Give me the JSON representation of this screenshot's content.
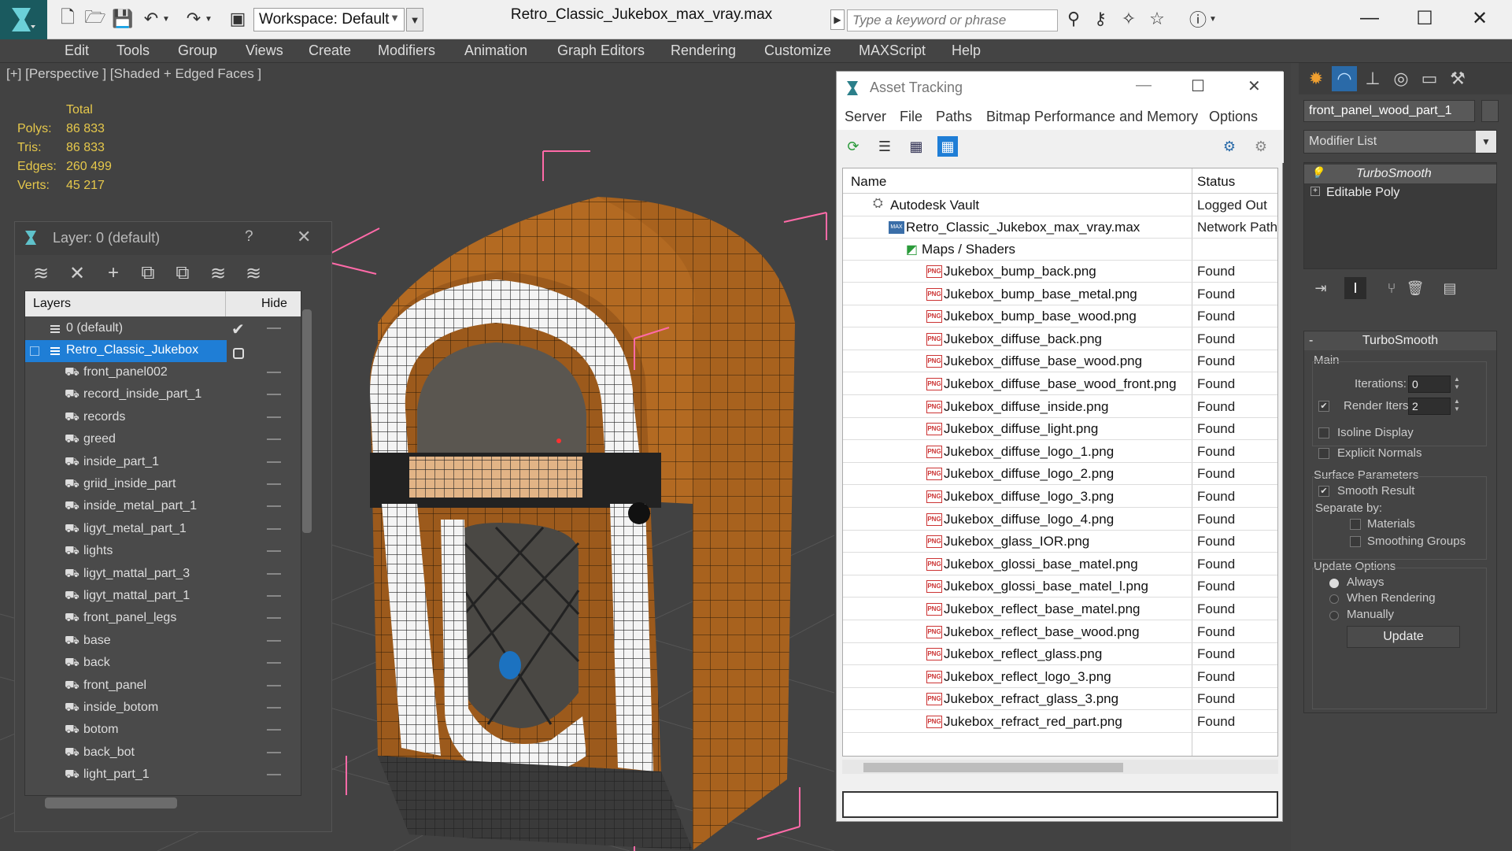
{
  "titlebar": {
    "workspace": "Workspace: Default",
    "doc_title": "Retro_Classic_Jukebox_max_vray.max",
    "search_placeholder": "Type a keyword or phrase"
  },
  "menu": [
    "Edit",
    "Tools",
    "Group",
    "Views",
    "Create",
    "Modifiers",
    "Animation",
    "Graph Editors",
    "Rendering",
    "Customize",
    "MAXScript",
    "Help"
  ],
  "viewport": {
    "label": "[+] [Perspective ] [Shaded + Edged Faces ]",
    "stats_header": "Total",
    "stats": [
      {
        "label": "Polys:",
        "value": "86 833"
      },
      {
        "label": "Tris:",
        "value": "86 833"
      },
      {
        "label": "Edges:",
        "value": "260 499"
      },
      {
        "label": "Verts:",
        "value": "45 217"
      }
    ]
  },
  "layer_panel": {
    "title": "Layer: 0 (default)",
    "help": "?",
    "col_layers": "Layers",
    "col_hide": "Hide",
    "default_layer": "0 (default)",
    "selected_layer": "Retro_Classic_Jukebox",
    "objects": [
      "front_panel002",
      "record_inside_part_1",
      "records",
      "greed",
      "inside_part_1",
      "griid_inside_part",
      "inside_metal_part_1",
      "ligyt_metal_part_1",
      "lights",
      "ligyt_mattal_part_3",
      "ligyt_mattal_part_1",
      "front_panel_legs",
      "base",
      "back",
      "front_panel",
      "inside_botom",
      "botom",
      "back_bot",
      "light_part_1"
    ]
  },
  "asset_panel": {
    "title": "Asset Tracking",
    "menu": [
      "Server",
      "File",
      "Paths",
      "Bitmap Performance and Memory",
      "Options"
    ],
    "col_name": "Name",
    "col_status": "Status",
    "vault": {
      "name": "Autodesk Vault",
      "status": "Logged Out"
    },
    "file": {
      "name": "Retro_Classic_Jukebox_max_vray.max",
      "status": "Network Path"
    },
    "maps": {
      "name": "Maps / Shaders",
      "status": ""
    },
    "files": [
      {
        "name": "Jukebox_bump_back.png",
        "status": "Found"
      },
      {
        "name": "Jukebox_bump_base_metal.png",
        "status": "Found"
      },
      {
        "name": "Jukebox_bump_base_wood.png",
        "status": "Found"
      },
      {
        "name": "Jukebox_diffuse_back.png",
        "status": "Found"
      },
      {
        "name": "Jukebox_diffuse_base_wood.png",
        "status": "Found"
      },
      {
        "name": "Jukebox_diffuse_base_wood_front.png",
        "status": "Found"
      },
      {
        "name": "Jukebox_diffuse_inside.png",
        "status": "Found"
      },
      {
        "name": "Jukebox_diffuse_light.png",
        "status": "Found"
      },
      {
        "name": "Jukebox_diffuse_logo_1.png",
        "status": "Found"
      },
      {
        "name": "Jukebox_diffuse_logo_2.png",
        "status": "Found"
      },
      {
        "name": "Jukebox_diffuse_logo_3.png",
        "status": "Found"
      },
      {
        "name": "Jukebox_diffuse_logo_4.png",
        "status": "Found"
      },
      {
        "name": "Jukebox_glass_IOR.png",
        "status": "Found"
      },
      {
        "name": "Jukebox_glossi_base_matel.png",
        "status": "Found"
      },
      {
        "name": "Jukebox_glossi_base_matel_l.png",
        "status": "Found"
      },
      {
        "name": "Jukebox_reflect_base_matel.png",
        "status": "Found"
      },
      {
        "name": "Jukebox_reflect_base_wood.png",
        "status": "Found"
      },
      {
        "name": "Jukebox_reflect_glass.png",
        "status": "Found"
      },
      {
        "name": "Jukebox_reflect_logo_3.png",
        "status": "Found"
      },
      {
        "name": "Jukebox_refract_glass_3.png",
        "status": "Found"
      },
      {
        "name": "Jukebox_refract_red_part.png",
        "status": "Found"
      }
    ]
  },
  "command_panel": {
    "object_name": "front_panel_wood_part_1",
    "modifier_list": "Modifier List",
    "stack": [
      "TurboSmooth",
      "Editable Poly"
    ],
    "rollout_title": "TurboSmooth",
    "main_label": "Main",
    "iterations_label": "Iterations:",
    "iterations_value": "0",
    "render_iters_label": "Render Iters:",
    "render_iters_value": "2",
    "isoline_display": "Isoline Display",
    "explicit_normals": "Explicit Normals",
    "surface_parameters": "Surface Parameters",
    "smooth_result": "Smooth Result",
    "separate_by": "Separate by:",
    "materials": "Materials",
    "smoothing_groups": "Smoothing Groups",
    "update_options": "Update Options",
    "always": "Always",
    "when_rendering": "When Rendering",
    "manually": "Manually",
    "update_button": "Update"
  },
  "colors": {
    "accent": "#1f7ed6",
    "selection": "#1f7ed6",
    "stats": "#e6c84b",
    "gizmo": "#ff6aa8"
  }
}
